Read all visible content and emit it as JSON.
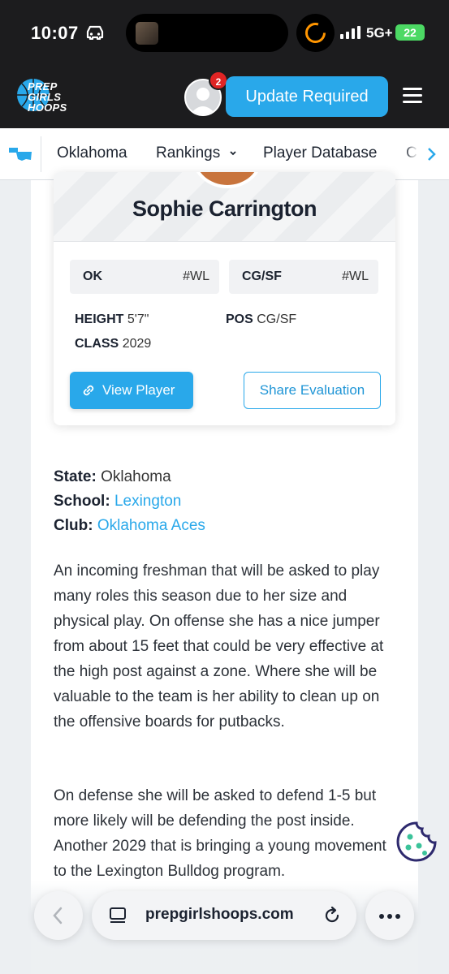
{
  "status_bar": {
    "time": "10:07",
    "network": "5G+",
    "battery": "22"
  },
  "header": {
    "logo_lines": [
      "PREP",
      "GIRLS",
      "HOOPS"
    ],
    "notification_count": "2",
    "update_label": "Update Required"
  },
  "nav": {
    "items": [
      "Oklahoma",
      "Rankings",
      "Player Database",
      "C"
    ]
  },
  "player": {
    "name": "Sophie Carrington",
    "state_abbr": "OK",
    "state_rank": "#WL",
    "position_abbr": "CG/SF",
    "position_rank": "#WL",
    "height_label": "HEIGHT",
    "height": "5'7\"",
    "pos_label": "POS",
    "pos": "CG/SF",
    "class_label": "CLASS",
    "class_year": "2029",
    "view_label": "View Player",
    "share_label": "Share Evaluation"
  },
  "info": {
    "state_label": "State:",
    "state": "Oklahoma",
    "school_label": "School:",
    "school": "Lexington",
    "club_label": "Club:",
    "club": "Oklahoma Aces"
  },
  "evaluation": {
    "para1": "An incoming freshman that will be asked to play many roles this season due to her size and physical play. On offense she has a nice jumper from about 15 feet that could be very effective at the high post against a zone. Where she will be valuable to the team is her ability to clean up on the offensive boards for putbacks.",
    "para2": "On defense she will be asked to defend 1-5 but more likely will be defending the post inside. Another 2029 that is bringing a young movement to the Lexington Bulldog program."
  },
  "browser": {
    "url": "prepgirlshoops.com"
  },
  "colors": {
    "accent": "#29a8ea",
    "header_bg": "#1c1c1e",
    "badge": "#e02424"
  }
}
